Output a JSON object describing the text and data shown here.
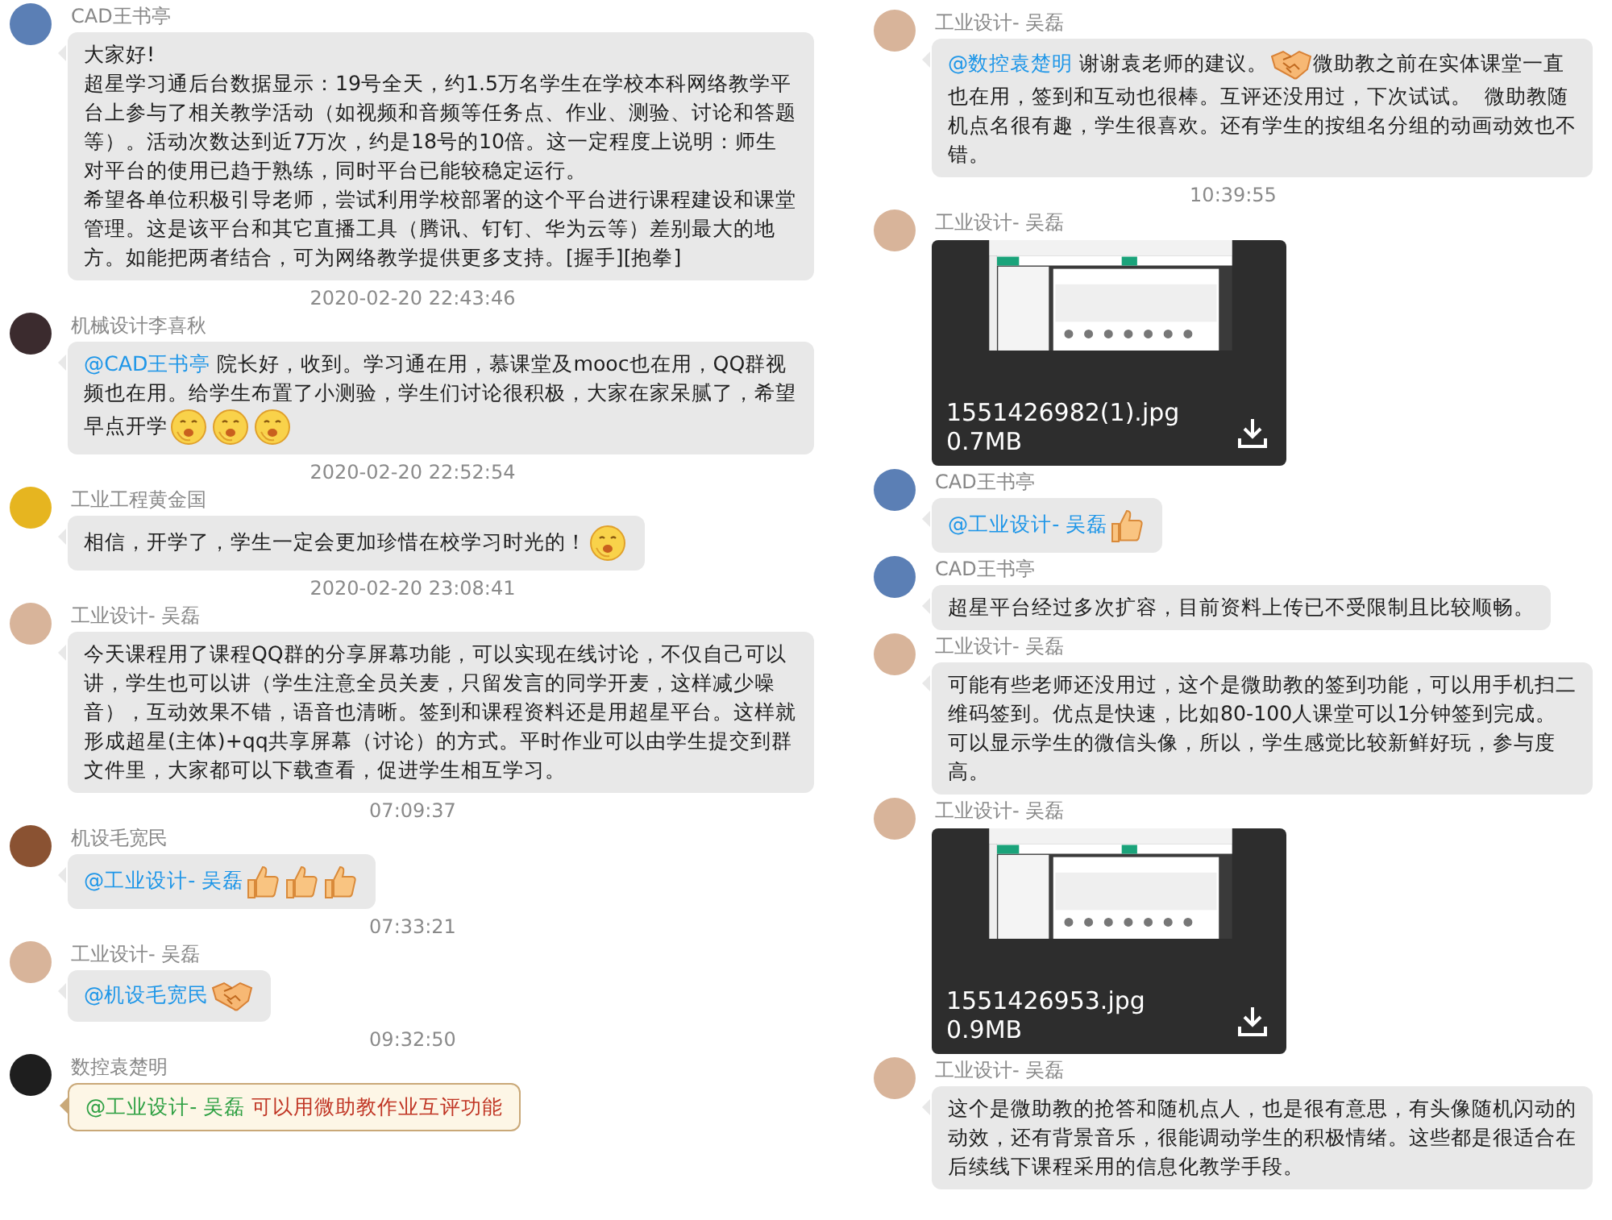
{
  "left": {
    "items": [
      {
        "kind": "message",
        "sender": "CAD王书亭",
        "color": "#5b7fb5",
        "highlighted": false,
        "paragraphs": [
          {
            "segments": [
              {
                "kind": "text",
                "text": "大家好!"
              }
            ]
          },
          {
            "segments": [
              {
                "kind": "text",
                "text": "超星学习通后台数据显示：19号全天，约1.5万名学生在学校本科网络教学平台上参与了相关教学活动（如视频和音频等任务点、作业、测验、讨论和答题等）。活动次数达到近7万次，约是18号的10倍。这一定程度上说明：师生对平台的使用已趋于熟练，同时平台已能较稳定运行。"
              }
            ]
          },
          {
            "segments": [
              {
                "kind": "text",
                "text": "希望各单位积极引导老师，尝试利用学校部署的这个平台进行课程建设和课堂管理。这是该平台和其它直播工具（腾讯、钉钉、华为云等）差别最大的地方。如能把两者结合，可为网络教学提供更多支持。[握手][抱拳]"
              }
            ]
          }
        ]
      },
      {
        "kind": "timestamp",
        "text": "2020-02-20 22:43:46"
      },
      {
        "kind": "message",
        "sender": "机械设计李喜秋",
        "color": "#3b2b2e",
        "highlighted": false,
        "paragraphs": [
          {
            "segments": [
              {
                "kind": "mention",
                "text": "@CAD王书亭"
              },
              {
                "kind": "text",
                "text": " 院长好，收到。学习通在用，慕课堂及mooc也在用，QQ群视频也在用。给学生布置了小测验，学生们讨论很积极，大家在家呆腻了，希望早点开学"
              },
              {
                "kind": "grin"
              },
              {
                "kind": "grin"
              },
              {
                "kind": "grin"
              }
            ]
          }
        ]
      },
      {
        "kind": "timestamp",
        "text": "2020-02-20 22:52:54"
      },
      {
        "kind": "message",
        "sender": "工业工程黄金国",
        "color": "#e6b520",
        "highlighted": false,
        "paragraphs": [
          {
            "segments": [
              {
                "kind": "text",
                "text": "相信，开学了，学生一定会更加珍惜在校学习时光的！"
              },
              {
                "kind": "grin"
              }
            ]
          }
        ]
      },
      {
        "kind": "timestamp",
        "text": "2020-02-20 23:08:41"
      },
      {
        "kind": "message",
        "sender": "工业设计- 吴磊",
        "color": "#d8b49a",
        "highlighted": false,
        "paragraphs": [
          {
            "segments": [
              {
                "kind": "text",
                "text": "今天课程用了课程QQ群的分享屏幕功能，可以实现在线讨论，不仅自己可以讲，学生也可以讲（学生注意全员关麦，只留发言的同学开麦，这样减少噪音），互动效果不错，语音也清晰。签到和课程资料还是用超星平台。这样就形成超星(主体)+qq共享屏幕（讨论）的方式。平时作业可以由学生提交到群文件里，大家都可以下载查看，促进学生相互学习。"
              }
            ]
          }
        ]
      },
      {
        "kind": "timestamp",
        "text": "07:09:37"
      },
      {
        "kind": "message",
        "sender": "机设毛宽民",
        "color": "#8a5232",
        "highlighted": false,
        "paragraphs": [
          {
            "segments": [
              {
                "kind": "mention",
                "text": "@工业设计- 吴磊"
              },
              {
                "kind": "thumbs_up"
              },
              {
                "kind": "thumbs_up"
              },
              {
                "kind": "thumbs_up"
              }
            ]
          }
        ]
      },
      {
        "kind": "timestamp",
        "text": "07:33:21"
      },
      {
        "kind": "message",
        "sender": "工业设计- 吴磊",
        "color": "#d8b49a",
        "highlighted": false,
        "paragraphs": [
          {
            "segments": [
              {
                "kind": "mention",
                "text": "@机设毛宽民"
              },
              {
                "kind": "handshake"
              }
            ]
          }
        ]
      },
      {
        "kind": "timestamp",
        "text": "09:32:50"
      },
      {
        "kind": "message",
        "sender": "数控袁楚明",
        "color": "#1e1e1e",
        "highlighted": true,
        "paragraphs": [
          {
            "segments": [
              {
                "kind": "mention",
                "text": "@工业设计- 吴磊"
              },
              {
                "kind": "text",
                "text": " 可以用微助教作业互评功能"
              }
            ]
          }
        ]
      }
    ]
  },
  "right": {
    "items": [
      {
        "kind": "message",
        "sender": "工业设计- 吴磊",
        "color": "#d8b49a",
        "highlighted": false,
        "paragraphs": [
          {
            "segments": [
              {
                "kind": "mention",
                "text": "@数控袁楚明"
              },
              {
                "kind": "text",
                "text": " 谢谢袁老师的建议。"
              },
              {
                "kind": "handshake"
              },
              {
                "kind": "text",
                "text": "微助教之前在实体课堂一直也在用，签到和互动也很棒。互评还没用过，下次试试。  微助教随机点名很有趣，学生很喜欢。还有学生的按组名分组的动画动效也不错。"
              }
            ]
          }
        ]
      },
      {
        "kind": "timestamp",
        "text": "10:39:55"
      },
      {
        "kind": "image",
        "sender": "工业设计- 吴磊",
        "color": "#d8b49a",
        "filename": "1551426982(1).jpg",
        "size": "0.7MB"
      },
      {
        "kind": "message",
        "sender": "CAD王书亭",
        "color": "#5b7fb5",
        "highlighted": false,
        "paragraphs": [
          {
            "segments": [
              {
                "kind": "mention",
                "text": "@工业设计- 吴磊"
              },
              {
                "kind": "thumbs_up"
              }
            ]
          }
        ]
      },
      {
        "kind": "message",
        "sender": "CAD王书亭",
        "color": "#5b7fb5",
        "highlighted": false,
        "paragraphs": [
          {
            "segments": [
              {
                "kind": "text",
                "text": "超星平台经过多次扩容，目前资料上传已不受限制且比较顺畅。"
              }
            ]
          }
        ]
      },
      {
        "kind": "message",
        "sender": "工业设计- 吴磊",
        "color": "#d8b49a",
        "highlighted": false,
        "paragraphs": [
          {
            "segments": [
              {
                "kind": "text",
                "text": "可能有些老师还没用过，这个是微助教的签到功能，可以用手机扫二维码签到。优点是快速，比如80-100人课堂可以1分钟签到完成。可以显示学生的微信头像，所以，学生感觉比较新鲜好玩，参与度高。"
              }
            ]
          }
        ]
      },
      {
        "kind": "image",
        "sender": "工业设计- 吴磊",
        "color": "#d8b49a",
        "filename": "1551426953.jpg",
        "size": "0.9MB"
      },
      {
        "kind": "message",
        "sender": "工业设计- 吴磊",
        "color": "#d8b49a",
        "highlighted": false,
        "paragraphs": [
          {
            "segments": [
              {
                "kind": "text",
                "text": "这个是微助教的抢答和随机点人，也是很有意思，有头像随机闪动的动效，还有背景音乐，很能调动学生的积极情绪。这些都是很适合在后续线下课程采用的信息化教学手段。"
              }
            ]
          }
        ]
      }
    ]
  }
}
